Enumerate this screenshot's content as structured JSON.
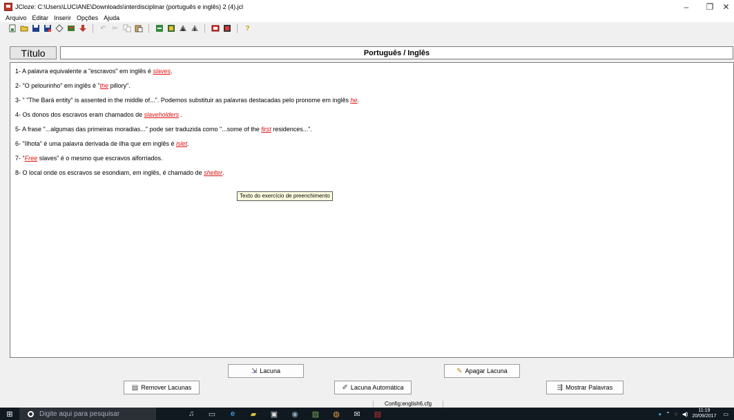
{
  "window": {
    "title": "JCloze: C:\\Users\\LUCIANE\\Downloads\\interdisciplinar (português e inglês) 2 (4).jcl",
    "minimize": "–",
    "maximize": "❐",
    "close": "✕"
  },
  "menu": [
    "Arquivo",
    "Editar",
    "Inserir",
    "Opções",
    "Ajuda"
  ],
  "toolbar": {
    "icons": [
      "new-file-icon",
      "open-folder-icon",
      "save-icon",
      "save-as-icon",
      "diamond-icon",
      "web-icon",
      "down-arrow-icon",
      "undo-icon",
      "cut-icon",
      "copy-icon",
      "paste-icon",
      "gap-icon",
      "clear-gap-icon",
      "auto-gap-icon",
      "remove-gaps-icon",
      "words-icon",
      "config-icon",
      "help-icon"
    ]
  },
  "title_row": {
    "label": "Título",
    "value": "Português / Inglês"
  },
  "exercise": {
    "lines": [
      [
        {
          "t": "1- A palavra equivalente a \"escravos\" em inglês é "
        },
        {
          "g": "slaves"
        },
        {
          "t": "."
        }
      ],
      [
        {
          "t": "2- \"O pelourinho\" em inglês é \""
        },
        {
          "g": "the"
        },
        {
          "t": " pillory\"."
        }
      ],
      [
        {
          "t": "3- \" \"The Bará entity\" is assented in the middle of...\". Podemos substituir as palavras destacadas pelo pronome em inglês "
        },
        {
          "g": "he"
        },
        {
          "t": "."
        }
      ],
      [
        {
          "t": "4- Os donos dos escravos eram chamados de "
        },
        {
          "g": "slaveholders"
        },
        {
          "t": " ."
        }
      ],
      [
        {
          "t": "5- A frase \"...algumas das primeiras moradias...\" pode ser traduzida como \"...some of the "
        },
        {
          "g": "first"
        },
        {
          "t": " residences...\"."
        }
      ],
      [
        {
          "t": "6- \"Ilhota\" é uma palavra derivada de ilha que em inglês é "
        },
        {
          "g": "islet"
        },
        {
          "t": "."
        }
      ],
      [
        {
          "t": "7- \""
        },
        {
          "g": "Free"
        },
        {
          "t": " slaves\" é o mesmo que escravos alforriados."
        }
      ],
      [
        {
          "t": "8- O local onde os escravos se esondiam, em inglês, é chamado de "
        },
        {
          "g": "shelter"
        },
        {
          "t": "."
        }
      ]
    ],
    "tooltip": "Texto do exercício de preenchimento"
  },
  "buttons": {
    "lacuna": "Lacuna",
    "apagar_lacuna": "Apagar Lacuna",
    "remover_lacunas": "Remover Lacunas",
    "lacuna_automatica": "Lacuna Automática",
    "mostrar_palavras": "Mostrar Palavras"
  },
  "status": "Config:english6.cfg",
  "taskbar": {
    "search_placeholder": "Digite aqui para pesquisar",
    "time": "11:19",
    "date": "20/09/2017"
  }
}
